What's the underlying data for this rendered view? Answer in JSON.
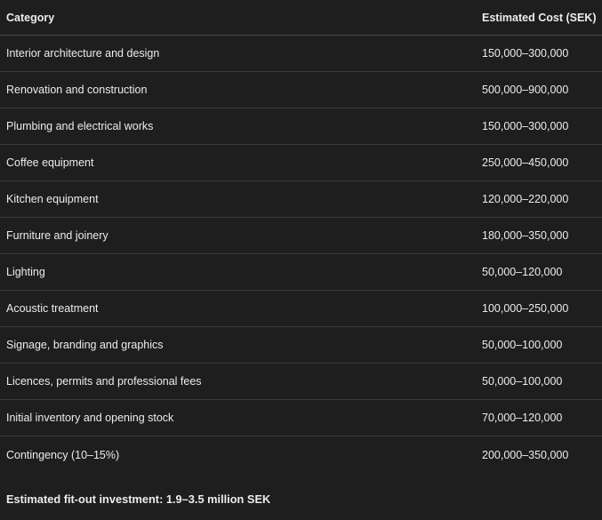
{
  "table": {
    "headers": {
      "category": "Category",
      "cost": "Estimated Cost (SEK)"
    },
    "rows": [
      {
        "category": "Interior architecture and design",
        "cost": "150,000–300,000"
      },
      {
        "category": "Renovation and construction",
        "cost": "500,000–900,000"
      },
      {
        "category": "Plumbing and electrical works",
        "cost": "150,000–300,000"
      },
      {
        "category": "Coffee equipment",
        "cost": "250,000–450,000"
      },
      {
        "category": "Kitchen equipment",
        "cost": "120,000–220,000"
      },
      {
        "category": "Furniture and joinery",
        "cost": "180,000–350,000"
      },
      {
        "category": "Lighting",
        "cost": "50,000–120,000"
      },
      {
        "category": "Acoustic treatment",
        "cost": "100,000–250,000"
      },
      {
        "category": "Signage, branding and graphics",
        "cost": "50,000–100,000"
      },
      {
        "category": "Licences, permits and professional fees",
        "cost": "50,000–100,000"
      },
      {
        "category": "Initial inventory and opening stock",
        "cost": "70,000–120,000"
      },
      {
        "category": "Contingency (10–15%)",
        "cost": "200,000–350,000"
      }
    ]
  },
  "summary": {
    "text": "Estimated fit-out investment: 1.9–3.5 million SEK"
  }
}
